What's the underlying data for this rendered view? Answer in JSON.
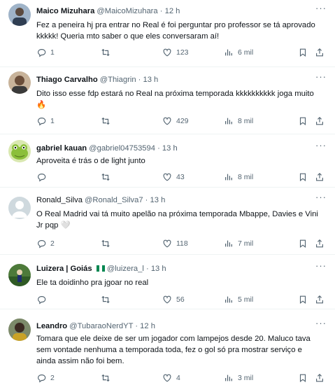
{
  "tweets": [
    {
      "name": "Maico Mizuhara",
      "handle": "@MaicoMizuhara",
      "dot": "·",
      "time": "12 h",
      "text": "Fez a peneira hj pra entrar no Real é foi perguntar pro professor se tá aprovado kkkkk! Queria mto saber o que eles conversaram aí!",
      "replies": "1",
      "retweets": "",
      "likes": "123",
      "views": "6 mil",
      "avatar": "avatar-photo"
    },
    {
      "name": "Thiago Carvalho",
      "handle": "@Thiagrin",
      "dot": "·",
      "time": "13 h",
      "text": "Dito isso esse fdp estará no Real na próxima temporada kkkkkkkkkk joga muito 🔥",
      "replies": "1",
      "retweets": "",
      "likes": "429",
      "views": "8 mil",
      "avatar": "avatar-photo"
    },
    {
      "name": "gabriel kauan",
      "handle": "@gabriel04753594",
      "dot": "·",
      "time": "13 h",
      "text": "Aproveita é trás o de light junto",
      "replies": "",
      "retweets": "",
      "likes": "43",
      "views": "8 mil",
      "avatar": "avatar-frog"
    },
    {
      "name": "Ronald_Silva",
      "handle": "@Ronald_Silva7",
      "dot": "·",
      "time": "13 h",
      "text": "O Real Madrid vai tá muito apelão  na próxima temporada Mbappe, Davies e Vini Jr pqp 🤍",
      "replies": "2",
      "retweets": "",
      "likes": "118",
      "views": "7 mil",
      "avatar": "avatar-default"
    },
    {
      "name": "Luizera | Goiás",
      "handle": "@luizera_l",
      "dot": "·",
      "time": "13 h",
      "text": "Ele ta doidinho pra jgoar no real",
      "replies": "",
      "retweets": "",
      "likes": "56",
      "views": "5 mil",
      "avatar": "avatar-photo",
      "flag": "nigeria-flag-icon"
    },
    {
      "name": "Leandro",
      "handle": "@TubaraoNerdYT",
      "dot": "·",
      "time": "12 h",
      "text": "Tomara que ele deixe de ser um jogador com lampejos desde 20. Maluco tava sem vontade nenhuma a temporada toda, fez o gol só pra mostrar serviço e ainda assim não foi bem.",
      "replies": "2",
      "retweets": "",
      "likes": "4",
      "views": "3 mil",
      "avatar": "avatar-photo"
    }
  ],
  "colors": {
    "text": "#0f1419",
    "muted": "#536471",
    "divider": "#eff3f4",
    "background": "#ffffff"
  },
  "icons": [
    "more-icon",
    "reply-icon",
    "retweet-icon",
    "like-icon",
    "views-icon",
    "bookmark-icon",
    "share-icon"
  ]
}
